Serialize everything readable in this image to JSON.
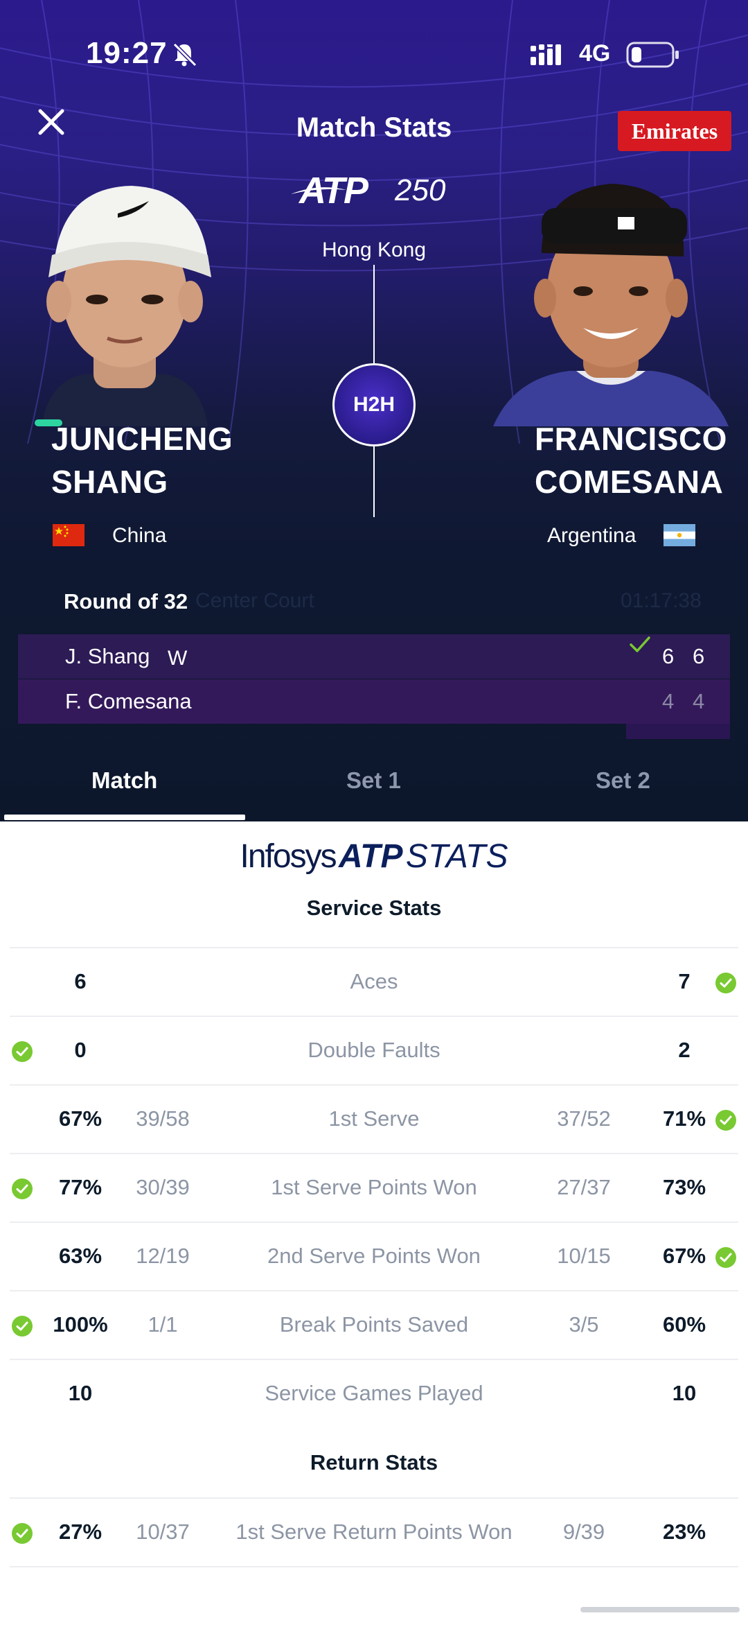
{
  "status_bar": {
    "time": "19:27",
    "network": "4G",
    "icons": [
      "bell-off-icon",
      "signal-icon",
      "battery-icon"
    ]
  },
  "header": {
    "title": "Match Stats",
    "sponsor": "Emirates",
    "close_icon": "close-icon"
  },
  "tournament": {
    "brand": "ATP",
    "level": "250",
    "venue": "Hong Kong",
    "h2h_label": "H2H"
  },
  "players": {
    "left": {
      "first": "JUNCHENG",
      "last": "SHANG",
      "country": "China",
      "flag": "china-flag-icon"
    },
    "right": {
      "first": "FRANCISCO",
      "last": "COMESANA",
      "country": "Argentina",
      "flag": "argentina-flag-icon"
    }
  },
  "match": {
    "round": "Round of 32",
    "court": "Center Court",
    "duration": "01:17:38",
    "rows": [
      {
        "name": "J. Shang",
        "marker": "W",
        "sets": [
          "6",
          "6"
        ]
      },
      {
        "name": "F. Comesana",
        "marker": "",
        "sets": [
          "4",
          "4"
        ]
      }
    ]
  },
  "tabs": [
    "Match",
    "Set 1",
    "Set 2"
  ],
  "stats_brand": {
    "infosys": "Infosys",
    "atp": "ATP",
    "stats": "STATS"
  },
  "service_stats": {
    "title": "Service Stats",
    "rows": [
      {
        "label": "Aces",
        "left": "6",
        "left_frac": "",
        "right": "7",
        "right_frac": "",
        "winner": "right"
      },
      {
        "label": "Double Faults",
        "left": "0",
        "left_frac": "",
        "right": "2",
        "right_frac": "",
        "winner": "left"
      },
      {
        "label": "1st Serve",
        "left": "67%",
        "left_frac": "39/58",
        "right": "71%",
        "right_frac": "37/52",
        "winner": "right"
      },
      {
        "label": "1st Serve Points Won",
        "left": "77%",
        "left_frac": "30/39",
        "right": "73%",
        "right_frac": "27/37",
        "winner": "left"
      },
      {
        "label": "2nd Serve Points Won",
        "left": "63%",
        "left_frac": "12/19",
        "right": "67%",
        "right_frac": "10/15",
        "winner": "right"
      },
      {
        "label": "Break Points Saved",
        "left": "100%",
        "left_frac": "1/1",
        "right": "60%",
        "right_frac": "3/5",
        "winner": "left"
      },
      {
        "label": "Service Games Played",
        "left": "10",
        "left_frac": "",
        "right": "10",
        "right_frac": "",
        "winner": ""
      }
    ]
  },
  "return_stats": {
    "title": "Return Stats",
    "rows": [
      {
        "label": "1st Serve Return Points Won",
        "left": "27%",
        "left_frac": "10/37",
        "right": "23%",
        "right_frac": "9/39",
        "winner": "left"
      }
    ]
  },
  "colors": {
    "check": "#79c932",
    "sponsor": "#d71921",
    "dark_bg": "#0d172c",
    "accent_purple": "#2c1b55"
  }
}
